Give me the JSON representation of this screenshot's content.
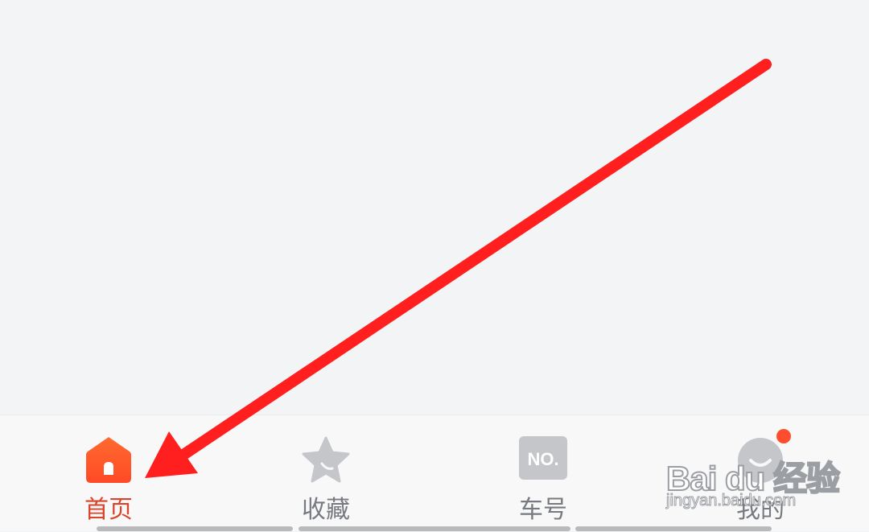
{
  "tab_bar": {
    "tabs": [
      {
        "label": "首页",
        "icon": "home-icon",
        "active": true
      },
      {
        "label": "收藏",
        "icon": "star-icon",
        "active": false
      },
      {
        "label": "车号",
        "icon": "number-icon",
        "active": false
      },
      {
        "label": "我的",
        "icon": "profile-icon",
        "active": false
      }
    ],
    "number_icon_text": "NO."
  },
  "watermark": {
    "brand": "Bai du 经验",
    "site": "jingyan.baidu.com"
  },
  "colors": {
    "active_tab": "#d9452c",
    "inactive_tab": "#777b80",
    "home_icon": "#ff5a2c",
    "badge": "#ff4d2d",
    "annotation_arrow": "#ff1f1f"
  }
}
